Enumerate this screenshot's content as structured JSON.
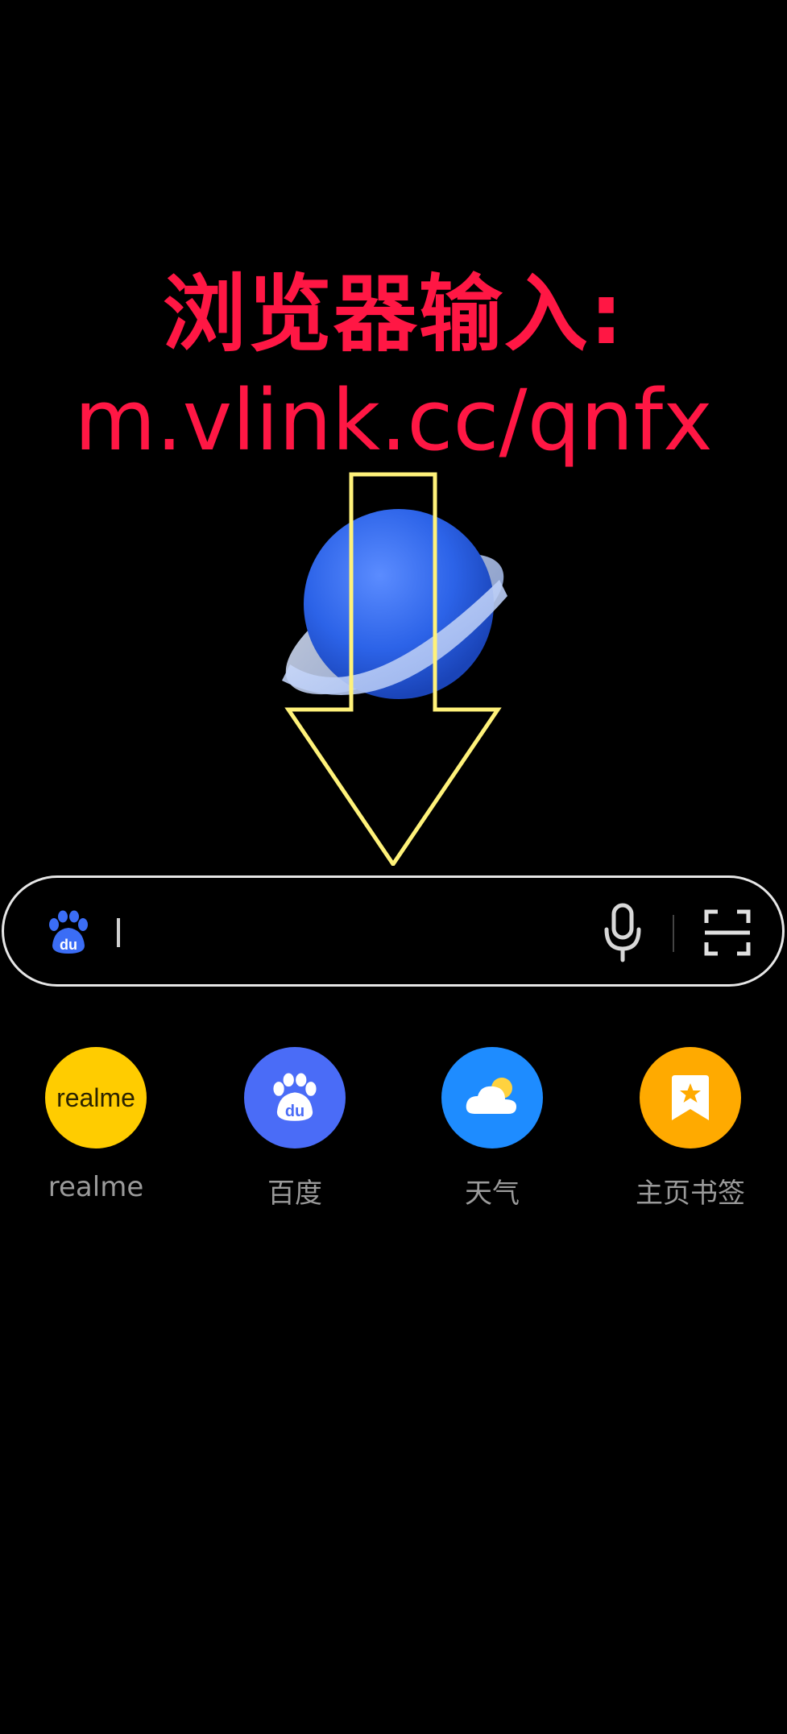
{
  "overlay": {
    "line1": "浏览器输入:",
    "line2": "m.vlink.cc/qnfx"
  },
  "search": {
    "engine_icon": "baidu-paw-icon",
    "mic_icon": "microphone-icon",
    "scan_icon": "scan-icon"
  },
  "shortcuts": [
    {
      "label": "realme",
      "badge_text": "realme",
      "color": "#ffcc00"
    },
    {
      "label": "百度",
      "icon": "baidu-paw-icon",
      "color": "#4a6cf7"
    },
    {
      "label": "天气",
      "icon": "weather-cloud-icon",
      "color": "#1e8cff"
    },
    {
      "label": "主页书签",
      "icon": "bookmark-star-icon",
      "color": "#ffaa00"
    }
  ],
  "colors": {
    "background": "#000000",
    "overlay_text": "#ff1744",
    "arrow_outline": "#fff27a"
  }
}
